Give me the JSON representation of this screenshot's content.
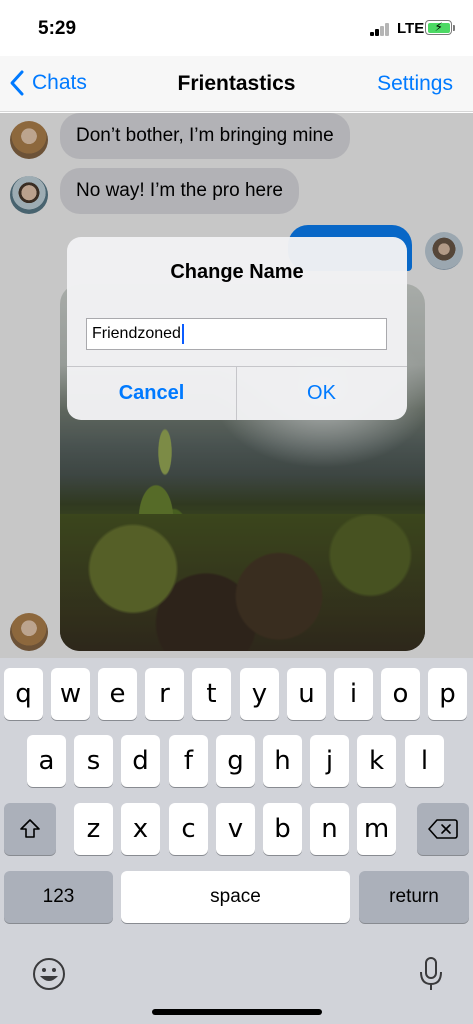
{
  "status_bar": {
    "time": "5:29",
    "network": "LTE"
  },
  "nav": {
    "back_label": "Chats",
    "title": "Frientastics",
    "settings_label": "Settings"
  },
  "messages": [
    {
      "text": "Don’t bother, I’m bringing mine"
    },
    {
      "text": "No way! I’m the pro here"
    }
  ],
  "alert": {
    "title": "Change Name",
    "input_value": "Friendzoned",
    "cancel_label": "Cancel",
    "ok_label": "OK"
  },
  "keyboard": {
    "row1": [
      "q",
      "w",
      "e",
      "r",
      "t",
      "y",
      "u",
      "i",
      "o",
      "p"
    ],
    "row2": [
      "a",
      "s",
      "d",
      "f",
      "g",
      "h",
      "j",
      "k",
      "l"
    ],
    "row3": [
      "z",
      "x",
      "c",
      "v",
      "b",
      "n",
      "m"
    ],
    "numbers_label": "123",
    "space_label": "space",
    "return_label": "return"
  },
  "colors": {
    "accent": "#007aff",
    "outgoing_bubble": "#0b84ff",
    "incoming_bubble": "#e5e5ea",
    "keyboard_bg": "#d1d3d9"
  }
}
